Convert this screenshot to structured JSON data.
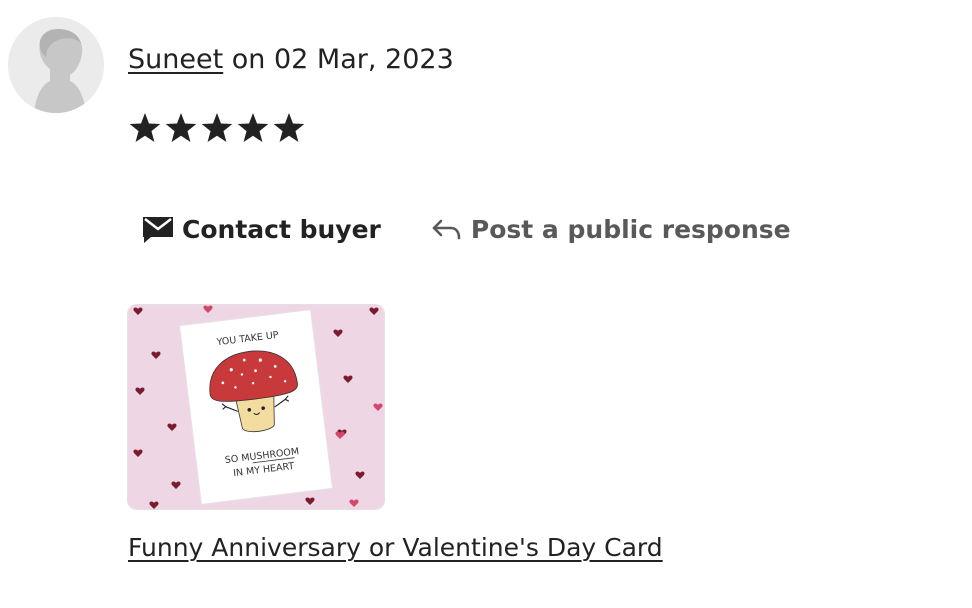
{
  "review": {
    "reviewer_name": "Suneet",
    "date_text": " on 02 Mar, 2023",
    "rating": 5,
    "star_glyph": "★",
    "star_color": "#222222"
  },
  "actions": {
    "contact_label": "Contact buyer",
    "contact_icon": "envelope-icon",
    "respond_label": "Post a public response",
    "respond_icon": "reply-arrow-icon"
  },
  "listing": {
    "card_lines": [
      "YOU TAKE UP",
      "SO MUSHROOM",
      "IN MY HEART"
    ],
    "title": "Funny Anniversary or Valentine's Day Card"
  },
  "colors": {
    "text": "#222222",
    "muted_text": "#595959",
    "avatar_bg": "#ebebeb",
    "thumb_bg": "#eed6e4",
    "mushroom_cap": "#c8393b"
  }
}
